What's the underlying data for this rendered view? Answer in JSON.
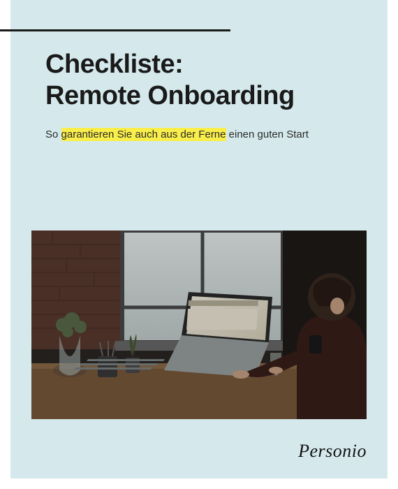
{
  "title_line1": "Checkliste:",
  "title_line2": "Remote Onboarding",
  "subtitle_pre": "So ",
  "subtitle_highlight": "garantieren Sie auch aus der Ferne",
  "subtitle_post": " einen guten Start",
  "brand": "Personio",
  "hero_alt": "Person working on a laptop at a wooden desk near a window, with plants and a glass of water",
  "colors": {
    "page_bg": "#d5e9ec",
    "highlight": "#f9ee4a",
    "text": "#1a1a1a"
  }
}
